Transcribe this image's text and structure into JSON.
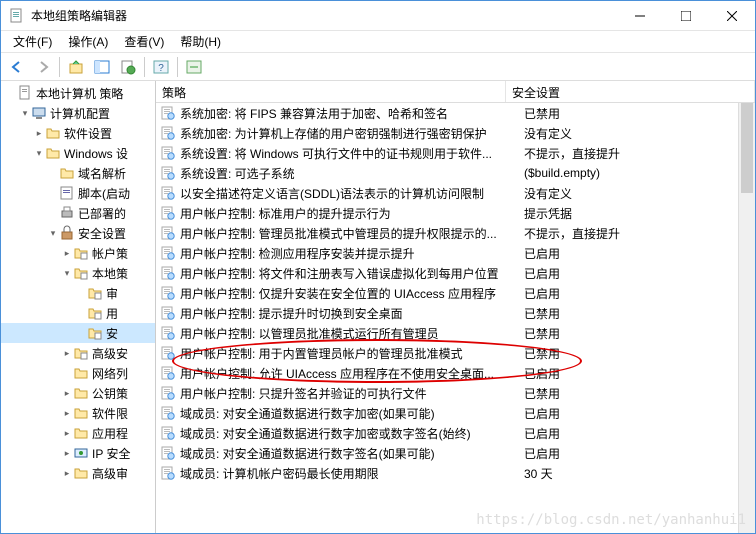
{
  "window": {
    "title": "本地组策略编辑器"
  },
  "menu": {
    "file": "文件(F)",
    "action": "操作(A)",
    "view": "查看(V)",
    "help": "帮助(H)"
  },
  "listheader": {
    "policy": "策略",
    "setting": "安全设置"
  },
  "tree": [
    {
      "indent": 0,
      "exp": "",
      "icon": "doc",
      "label": "本地计算机 策略"
    },
    {
      "indent": 1,
      "exp": "▾",
      "icon": "computer",
      "label": "计算机配置"
    },
    {
      "indent": 2,
      "exp": "▸",
      "icon": "folder",
      "label": "软件设置"
    },
    {
      "indent": 2,
      "exp": "▾",
      "icon": "folder",
      "label": "Windows 设"
    },
    {
      "indent": 3,
      "exp": "",
      "icon": "folder",
      "label": "域名解析"
    },
    {
      "indent": 3,
      "exp": "",
      "icon": "script",
      "label": "脚本(启动"
    },
    {
      "indent": 3,
      "exp": "",
      "icon": "printer",
      "label": "已部署的"
    },
    {
      "indent": 3,
      "exp": "▾",
      "icon": "lock",
      "label": "安全设置"
    },
    {
      "indent": 4,
      "exp": "▸",
      "icon": "folder2",
      "label": "帐户策"
    },
    {
      "indent": 4,
      "exp": "▾",
      "icon": "folder2",
      "label": "本地策"
    },
    {
      "indent": 5,
      "exp": "",
      "icon": "folder2",
      "label": "审"
    },
    {
      "indent": 5,
      "exp": "",
      "icon": "folder2",
      "label": "用"
    },
    {
      "indent": 5,
      "exp": "",
      "icon": "folder2",
      "label": "安",
      "selected": true
    },
    {
      "indent": 4,
      "exp": "▸",
      "icon": "folder2",
      "label": "高级安"
    },
    {
      "indent": 4,
      "exp": "",
      "icon": "folder",
      "label": "网络列"
    },
    {
      "indent": 4,
      "exp": "▸",
      "icon": "folder",
      "label": "公钥策"
    },
    {
      "indent": 4,
      "exp": "▸",
      "icon": "folder",
      "label": "软件限"
    },
    {
      "indent": 4,
      "exp": "▸",
      "icon": "folder",
      "label": "应用程"
    },
    {
      "indent": 4,
      "exp": "▸",
      "icon": "ip",
      "label": "IP 安全"
    },
    {
      "indent": 4,
      "exp": "▸",
      "icon": "folder",
      "label": "高级审"
    }
  ],
  "rows": [
    {
      "policy": "系统加密: 将 FIPS 兼容算法用于加密、哈希和签名",
      "setting": "已禁用"
    },
    {
      "policy": "系统加密: 为计算机上存储的用户密钥强制进行强密钥保护",
      "setting": "没有定义"
    },
    {
      "policy": "系统设置: 将 Windows 可执行文件中的证书规则用于软件...",
      "setting": "不提示，直接提升"
    },
    {
      "policy": "系统设置: 可选子系统",
      "setting": "($build.empty)"
    },
    {
      "policy": "以安全描述符定义语言(SDDL)语法表示的计算机访问限制",
      "setting": "没有定义"
    },
    {
      "policy": "用户帐户控制: 标准用户的提升提示行为",
      "setting": "提示凭据"
    },
    {
      "policy": "用户帐户控制: 管理员批准模式中管理员的提升权限提示的...",
      "setting": "不提示，直接提升"
    },
    {
      "policy": "用户帐户控制: 检测应用程序安装并提示提升",
      "setting": "已启用"
    },
    {
      "policy": "用户帐户控制: 将文件和注册表写入错误虚拟化到每用户位置",
      "setting": "已启用"
    },
    {
      "policy": "用户帐户控制: 仅提升安装在安全位置的 UIAccess 应用程序",
      "setting": "已启用"
    },
    {
      "policy": "用户帐户控制: 提示提升时切换到安全桌面",
      "setting": "已禁用"
    },
    {
      "policy": "用户帐户控制: 以管理员批准模式运行所有管理员",
      "setting": "已禁用"
    },
    {
      "policy": "用户帐户控制: 用于内置管理员帐户的管理员批准模式",
      "setting": "已禁用"
    },
    {
      "policy": "用户帐户控制: 允许 UIAccess 应用程序在不使用安全桌面...",
      "setting": "已启用"
    },
    {
      "policy": "用户帐户控制: 只提升签名并验证的可执行文件",
      "setting": "已禁用"
    },
    {
      "policy": "域成员: 对安全通道数据进行数字加密(如果可能)",
      "setting": "已启用"
    },
    {
      "policy": "域成员: 对安全通道数据进行数字加密或数字签名(始终)",
      "setting": "已启用"
    },
    {
      "policy": "域成员: 对安全通道数据进行数字签名(如果可能)",
      "setting": "已启用"
    },
    {
      "policy": "域成员: 计算机帐户密码最长使用期限",
      "setting": "30 天"
    }
  ],
  "watermark": "https://blog.csdn.net/yanhanhui1"
}
